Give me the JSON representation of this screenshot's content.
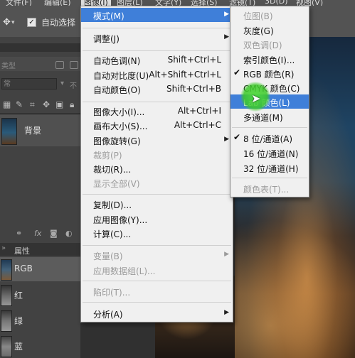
{
  "menubar": {
    "items": [
      "文件(F)",
      "编辑(E)",
      "图像(I)",
      "图层(L)",
      "文字(Y)",
      "选择(S)",
      "滤镜(T)",
      "3D(D)",
      "视图(V)"
    ]
  },
  "options": {
    "auto_select_label": "自动选择",
    "checkbox_mark": "✓"
  },
  "layers_panel": {
    "kind_label": "类型",
    "blend_label": "常",
    "opacity_label": "不",
    "layer_name": "背景"
  },
  "channels_panel": {
    "title": "属性",
    "channels": [
      "RGB",
      "红",
      "绿",
      "蓝"
    ]
  },
  "image_menu": {
    "items": [
      {
        "label": "模式(M)",
        "submenu": true,
        "highlighted": true
      },
      {
        "label": "调整(J)",
        "submenu": true
      },
      {
        "label": "自动色调(N)",
        "shortcut": "Shift+Ctrl+L"
      },
      {
        "label": "自动对比度(U)",
        "shortcut": "Alt+Shift+Ctrl+L"
      },
      {
        "label": "自动颜色(O)",
        "shortcut": "Shift+Ctrl+B"
      },
      {
        "label": "图像大小(I)...",
        "shortcut": "Alt+Ctrl+I"
      },
      {
        "label": "画布大小(S)...",
        "shortcut": "Alt+Ctrl+C"
      },
      {
        "label": "图像旋转(G)",
        "submenu": true
      },
      {
        "label": "裁剪(P)",
        "disabled": true
      },
      {
        "label": "裁切(R)..."
      },
      {
        "label": "显示全部(V)",
        "disabled": true
      },
      {
        "label": "复制(D)..."
      },
      {
        "label": "应用图像(Y)..."
      },
      {
        "label": "计算(C)..."
      },
      {
        "label": "变量(B)",
        "submenu": true,
        "disabled": true
      },
      {
        "label": "应用数据组(L)...",
        "disabled": true
      },
      {
        "label": "陷印(T)...",
        "disabled": true
      },
      {
        "label": "分析(A)",
        "submenu": true
      }
    ]
  },
  "mode_submenu": {
    "items": [
      {
        "label": "位图(B)",
        "disabled": true
      },
      {
        "label": "灰度(G)"
      },
      {
        "label": "双色调(D)",
        "disabled": true
      },
      {
        "label": "索引颜色(I)..."
      },
      {
        "label": "RGB 颜色(R)",
        "checked": true
      },
      {
        "label": "CMYK 颜色(C)"
      },
      {
        "label": "Lab 颜色(L)",
        "highlighted": true
      },
      {
        "label": "多通道(M)"
      },
      {
        "label": "8 位/通道(A)",
        "checked": true
      },
      {
        "label": "16 位/通道(N)"
      },
      {
        "label": "32 位/通道(H)"
      },
      {
        "label": "颜色表(T)...",
        "disabled": true
      }
    ]
  }
}
